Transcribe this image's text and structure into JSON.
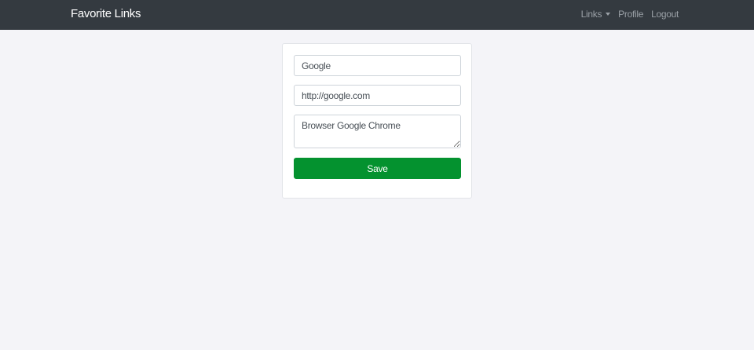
{
  "navbar": {
    "brand": "Favorite Links",
    "links_label": "Links",
    "profile_label": "Profile",
    "logout_label": "Logout"
  },
  "form": {
    "title_value": "Google",
    "url_value": "http://google.com",
    "description_value": "Browser Google Chrome",
    "save_label": "Save"
  },
  "colors": {
    "navbar_bg": "#343a40",
    "save_button": "#04922f",
    "page_bg": "#f4f4f8"
  }
}
